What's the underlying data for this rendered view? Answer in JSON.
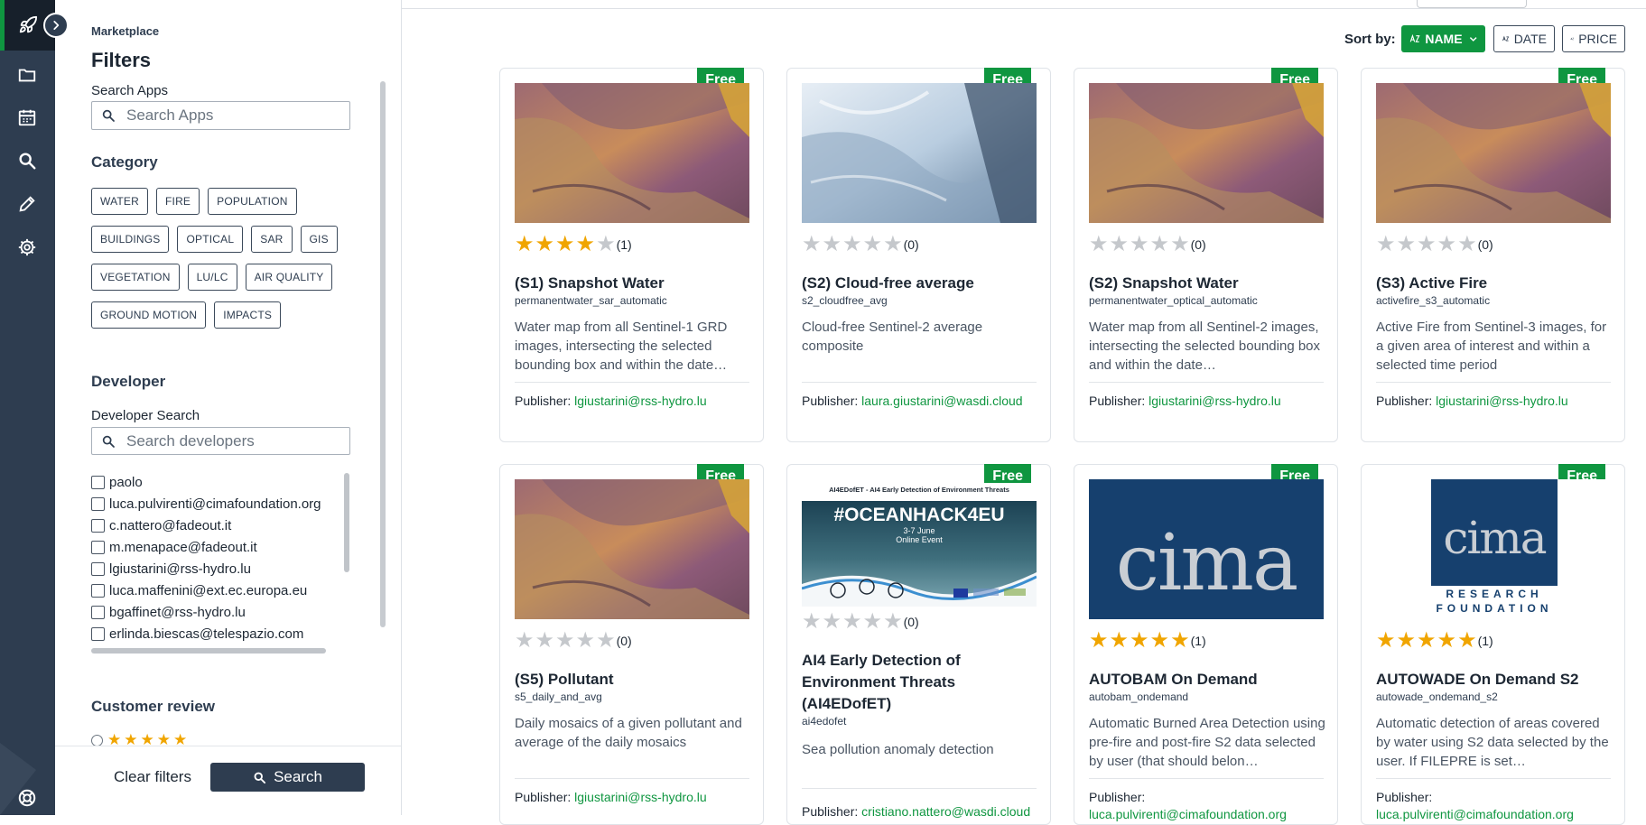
{
  "breadcrumb": "Marketplace",
  "filters_title": "Filters",
  "search_apps": {
    "label": "Search Apps",
    "placeholder": "Search Apps"
  },
  "category": {
    "title": "Category",
    "chips": [
      "WATER",
      "FIRE",
      "POPULATION",
      "BUILDINGS",
      "OPTICAL",
      "SAR",
      "GIS",
      "VEGETATION",
      "LU/LC",
      "AIR QUALITY",
      "GROUND MOTION",
      "IMPACTS"
    ]
  },
  "developer": {
    "title": "Developer",
    "search_label": "Developer Search",
    "placeholder": "Search developers",
    "list": [
      "paolo",
      "luca.pulvirenti@cimafoundation.org",
      "c.nattero@fadeout.it",
      "m.menapace@fadeout.it",
      "lgiustarini@rss-hydro.lu",
      "luca.maffenini@ext.ec.europa.eu",
      "bgaffinet@rss-hydro.lu",
      "erlinda.biescas@telespazio.com"
    ]
  },
  "customer_review": {
    "title": "Customer review",
    "stars": 5
  },
  "footer": {
    "clear": "Clear filters",
    "search": "Search"
  },
  "sort": {
    "label": "Sort by:",
    "name": "NAME",
    "date": "DATE",
    "price": "PRICE"
  },
  "colors": {
    "accent": "#0f9640",
    "rail": "#2e3d50",
    "star": "#f0a500"
  },
  "rail_icons": [
    "rocket-icon",
    "folder-icon",
    "calendar-icon",
    "search-icon",
    "pencil-icon",
    "gear-icon",
    "support-icon"
  ],
  "cards": [
    {
      "badge": "Free",
      "rating": 4,
      "count": "(1)",
      "title": "(S1) Snapshot Water",
      "code": "permanentwater_sar_automatic",
      "desc": "Water map from all Sentinel-1 GRD images, intersecting the selected bounding box and within the date…",
      "pub_label": "Publisher:",
      "publisher": "lgiustarini@rss-hydro.lu"
    },
    {
      "badge": "Free",
      "rating": 0,
      "count": "(0)",
      "title": "(S2) Cloud-free average",
      "code": "s2_cloudfree_avg",
      "desc": "Cloud-free Sentinel-2 average composite",
      "pub_label": "Publisher:",
      "publisher": "laura.giustarini@wasdi.cloud"
    },
    {
      "badge": "Free",
      "rating": 0,
      "count": "(0)",
      "title": "(S2) Snapshot Water",
      "code": "permanentwater_optical_automatic",
      "desc": "Water map from all Sentinel-2 images, intersecting the selected bounding box and within the date…",
      "pub_label": "Publisher:",
      "publisher": "lgiustarini@rss-hydro.lu"
    },
    {
      "badge": "Free",
      "rating": 0,
      "count": "(0)",
      "title": "(S3) Active Fire",
      "code": "activefire_s3_automatic",
      "desc": "Active Fire from Sentinel-3 images, for a given area of interest and within a selected time period",
      "pub_label": "Publisher:",
      "publisher": "lgiustarini@rss-hydro.lu"
    },
    {
      "badge": "Free",
      "rating": 0,
      "count": "(0)",
      "title": "(S5) Pollutant",
      "code": "s5_daily_and_avg",
      "desc": "Daily mosaics of a given pollutant and average of the daily mosaics",
      "pub_label": "Publisher:",
      "publisher": "lgiustarini@rss-hydro.lu"
    },
    {
      "badge": "Free",
      "rating": 0,
      "count": "(0)",
      "title": "AI4 Early Detection of Environment Threats (AI4EDofET)",
      "code": "ai4edofet",
      "desc": "Sea pollution anomaly detection",
      "pub_label": "Publisher:",
      "publisher": "cristiano.nattero@wasdi.cloud",
      "banner_top": "AI4EDofET - AI4 Early Detection of Environment Threats",
      "banner_tag": "#OCEANHACK4EU",
      "banner_dates": "3-7 June",
      "banner_event": "Online Event"
    },
    {
      "badge": "Free",
      "rating": 5,
      "count": "(1)",
      "title": "AUTOBAM On Demand",
      "code": "autobam_ondemand",
      "desc": "Automatic Burned Area Detection using pre-fire and post-fire S2 data selected by user (that should belon…",
      "pub_label": "Publisher:",
      "publisher": "luca.pulvirenti@cimafoundation.org",
      "logo": "cima"
    },
    {
      "badge": "Free",
      "rating": 5,
      "count": "(1)",
      "title": "AUTOWADE On Demand S2",
      "code": "autowade_ondemand_s2",
      "desc": "Automatic detection of areas covered by water using S2 data selected by the user. If FILEPRE is set…",
      "pub_label": "Publisher:",
      "publisher": "luca.pulvirenti@cimafoundation.org",
      "logo": "cima",
      "logo_sub1": "RESEARCH",
      "logo_sub2": "FOUNDATION"
    }
  ]
}
